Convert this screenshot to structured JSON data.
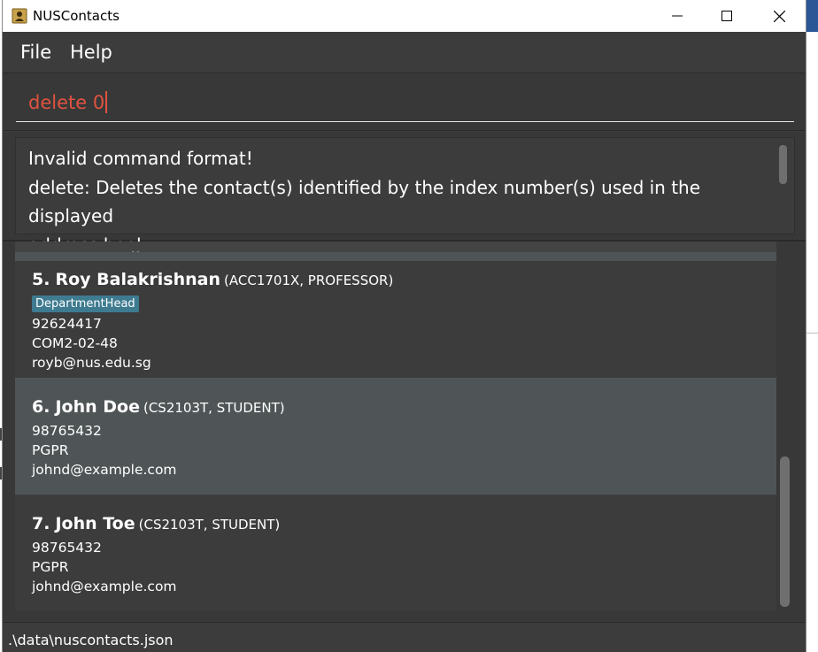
{
  "window": {
    "title": "NUSContacts"
  },
  "menu": {
    "items": [
      "File",
      "Help"
    ]
  },
  "command_box": {
    "value": "delete 0"
  },
  "result_display": {
    "lines": [
      "Invalid command format!",
      "delete: Deletes the contact(s) identified by the index number(s) used in the displayed",
      "address book."
    ]
  },
  "contacts": [
    {
      "index": "5.",
      "name": "Roy Balakrishnan",
      "meta": "(ACC1701X,  PROFESSOR)",
      "tag": "DepartmentHead",
      "phone": "92624417",
      "address": "COM2-02-48",
      "email": "royb@nus.edu.sg",
      "selected": false
    },
    {
      "index": "6.",
      "name": "John Doe",
      "meta": "(CS2103T,  STUDENT)",
      "phone": "98765432",
      "address": "PGPR",
      "email": "johnd@example.com",
      "selected": true
    },
    {
      "index": "7.",
      "name": "John Toe",
      "meta": "(CS2103T,  STUDENT)",
      "phone": "98765432",
      "address": "PGPR",
      "email": "johnd@example.com",
      "selected": false
    }
  ],
  "status_bar": {
    "path": ".\\data\\nuscontacts.json"
  },
  "colors": {
    "background": "#3c3c3c",
    "selected_row": "#4f5556",
    "command_error_text": "#e0533f",
    "tag_background": "#3e7b91"
  },
  "icons": {
    "app": "contact-book-icon",
    "minimize": "minimize-icon",
    "maximize": "maximize-icon",
    "close": "close-icon"
  }
}
